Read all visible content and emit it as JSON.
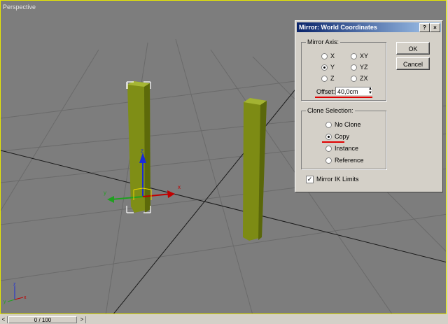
{
  "viewport": {
    "label": "Perspective"
  },
  "gizmo": {
    "axis_z": "z",
    "axis_y": "y",
    "axis_x": "x"
  },
  "corner_axes": {
    "z": "z",
    "y": "y",
    "x": "x"
  },
  "dialog": {
    "title": "Mirror: World Coordinates",
    "help_btn": "?",
    "close_btn": "×",
    "mirror_axis": {
      "title": "Mirror Axis:",
      "options": [
        {
          "label": "X",
          "selected": false
        },
        {
          "label": "Y",
          "selected": true
        },
        {
          "label": "Z",
          "selected": false
        },
        {
          "label": "XY",
          "selected": false
        },
        {
          "label": "YZ",
          "selected": false
        },
        {
          "label": "ZX",
          "selected": false
        }
      ],
      "offset_label": "Offset:",
      "offset_value": "40,0cm"
    },
    "clone_selection": {
      "title": "Clone Selection:",
      "options": [
        {
          "label": "No Clone",
          "selected": false
        },
        {
          "label": "Copy",
          "selected": true
        },
        {
          "label": "Instance",
          "selected": false
        },
        {
          "label": "Reference",
          "selected": false
        }
      ]
    },
    "mirror_ik": {
      "label": "Mirror IK Limits",
      "checked": true
    },
    "ok_label": "OK",
    "cancel_label": "Cancel"
  },
  "timebar": {
    "slider_text": "0 / 100",
    "prev": "<",
    "next": ">"
  },
  "colors": {
    "viewport_bg": "#7d7d7d",
    "object": "#8c9a1c",
    "highlight": "#e00000",
    "title_start": "#0a246a"
  }
}
